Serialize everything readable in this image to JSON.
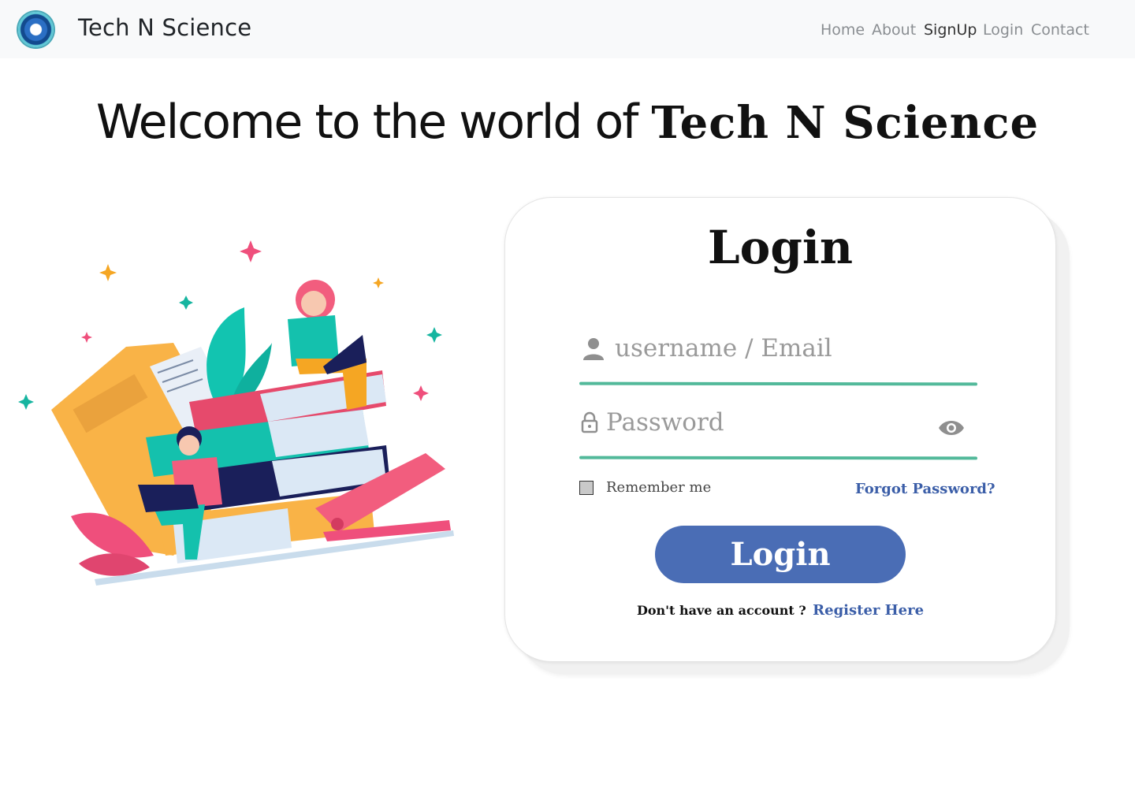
{
  "navbar": {
    "brand": "Tech N Science",
    "logo_icon": "science-globe-logo",
    "links": [
      {
        "label": "Home",
        "active": false
      },
      {
        "label": "About",
        "active": false
      },
      {
        "label": "SignUp",
        "active": true
      },
      {
        "label": "Login",
        "active": false
      },
      {
        "label": "Contact",
        "active": false
      }
    ]
  },
  "hero": {
    "prefix": "Welcome to the world of",
    "highlight": "Tech N Science"
  },
  "login_card": {
    "title": "Login",
    "username_placeholder": "username / Email",
    "password_placeholder": "Password",
    "remember_label": "Remember me",
    "forgot_label": "Forgot Password?",
    "submit_label": "Login",
    "signup_prompt": "Don't have an account ?",
    "register_label": "Register Here"
  },
  "colors": {
    "accent": "#4a6db5",
    "underline": "#52b99a",
    "link": "#3b5ea8",
    "navbar_bg": "#f8f9fa"
  },
  "icons": [
    "user-icon",
    "lock-icon",
    "eye-icon"
  ]
}
